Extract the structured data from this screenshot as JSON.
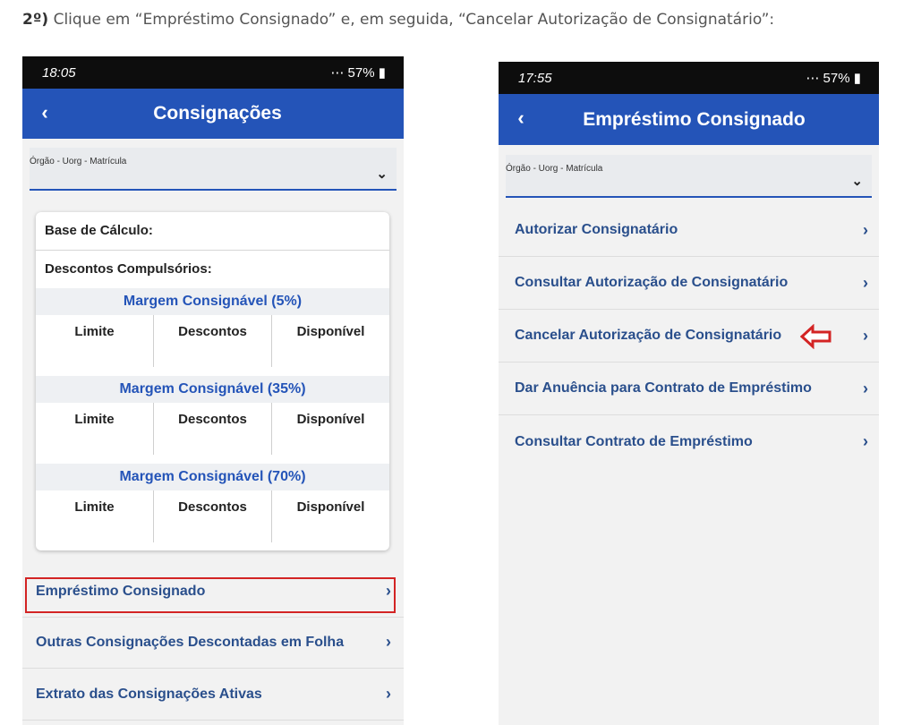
{
  "instruction": {
    "step": "2º)",
    "text": "Clique em “Empréstimo Consignado” e, em seguida, “Cancelar Autorização de Consignatário”:"
  },
  "left_phone": {
    "status": {
      "time": "18:05",
      "right": "57%"
    },
    "header": {
      "title": "Consignações",
      "back_icon": "chevron-left"
    },
    "select": {
      "label": "Órgão - Uorg - Matrícula"
    },
    "card": {
      "base_label": "Base de Cálculo:",
      "descontos_label": "Descontos Compulsórios:",
      "margins": [
        {
          "title": "Margem Consignável (5%)",
          "cols": [
            "Limite",
            "Descontos",
            "Disponível"
          ]
        },
        {
          "title": "Margem Consignável (35%)",
          "cols": [
            "Limite",
            "Descontos",
            "Disponível"
          ]
        },
        {
          "title": "Margem Consignável (70%)",
          "cols": [
            "Limite",
            "Descontos",
            "Disponível"
          ]
        }
      ]
    },
    "menu": [
      {
        "label": "Empréstimo Consignado",
        "highlighted": true
      },
      {
        "label": "Outras Consignações Descontadas em Folha"
      },
      {
        "label": "Extrato das Consignações Ativas"
      }
    ]
  },
  "right_phone": {
    "status": {
      "time": "17:55",
      "right": "57%"
    },
    "header": {
      "title": "Empréstimo Consignado",
      "back_icon": "chevron-left"
    },
    "select": {
      "label": "Órgão - Uorg - Matrícula"
    },
    "menu": [
      {
        "label": "Autorizar Consignatário"
      },
      {
        "label": "Consultar Autorização de Consignatário"
      },
      {
        "label": "Cancelar Autorização de Consignatário",
        "pointer_arrow": true
      },
      {
        "label": "Dar Anuência para Contrato de Empréstimo"
      },
      {
        "label": "Consultar Contrato de Empréstimo"
      }
    ]
  },
  "colors": {
    "header_blue": "#2454b8",
    "menu_text": "#2a4f8c",
    "highlight_red": "#d32424"
  }
}
